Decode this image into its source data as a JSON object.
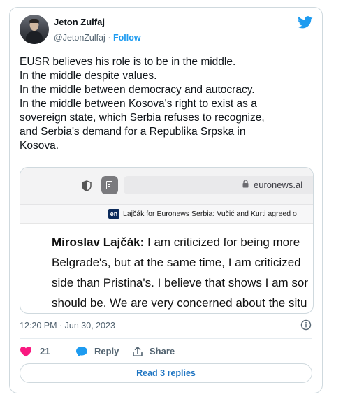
{
  "author": {
    "name": "Jeton Zulfaj",
    "handle": "@JetonZulfaj",
    "separator": "·",
    "follow_label": "Follow"
  },
  "tweet": {
    "lines": [
      "EUSR believes his role is to be in the middle.",
      "In the middle despite values.",
      "In the middle between democracy and autocracy.",
      "In the middle between Kosova's right to exist as a",
      "sovereign state, which Serbia refuses to recognize,",
      "and Serbia's demand for a Republika Srpska in",
      "Kosova."
    ]
  },
  "media": {
    "url": "euronews.al",
    "badge": "en",
    "headline": "Lajčák for Euronews Serbia: Vučić and Kurti agreed o",
    "quote_speaker": "Miroslav Lajčák:",
    "quote_lines": [
      " I am criticized for being more",
      "Belgrade's, but at the same time, I am criticized",
      "side than Pristina's. I believe that shows I am sor",
      "should be. We are very concerned about the situ"
    ]
  },
  "meta": {
    "timestamp": "12:20 PM · Jun 30, 2023"
  },
  "actions": {
    "like_count": "21",
    "reply_label": "Reply",
    "share_label": "Share"
  },
  "read_replies_label": "Read 3 replies",
  "colors": {
    "accent": "#1d9bf0",
    "like": "#f91880",
    "border": "#cfd9de",
    "secondary_text": "#536471"
  },
  "icons": [
    "twitter-bird-icon",
    "shield-icon",
    "tabs-icon",
    "lock-icon",
    "info-icon",
    "heart-icon",
    "reply-bubble-icon",
    "share-icon"
  ]
}
